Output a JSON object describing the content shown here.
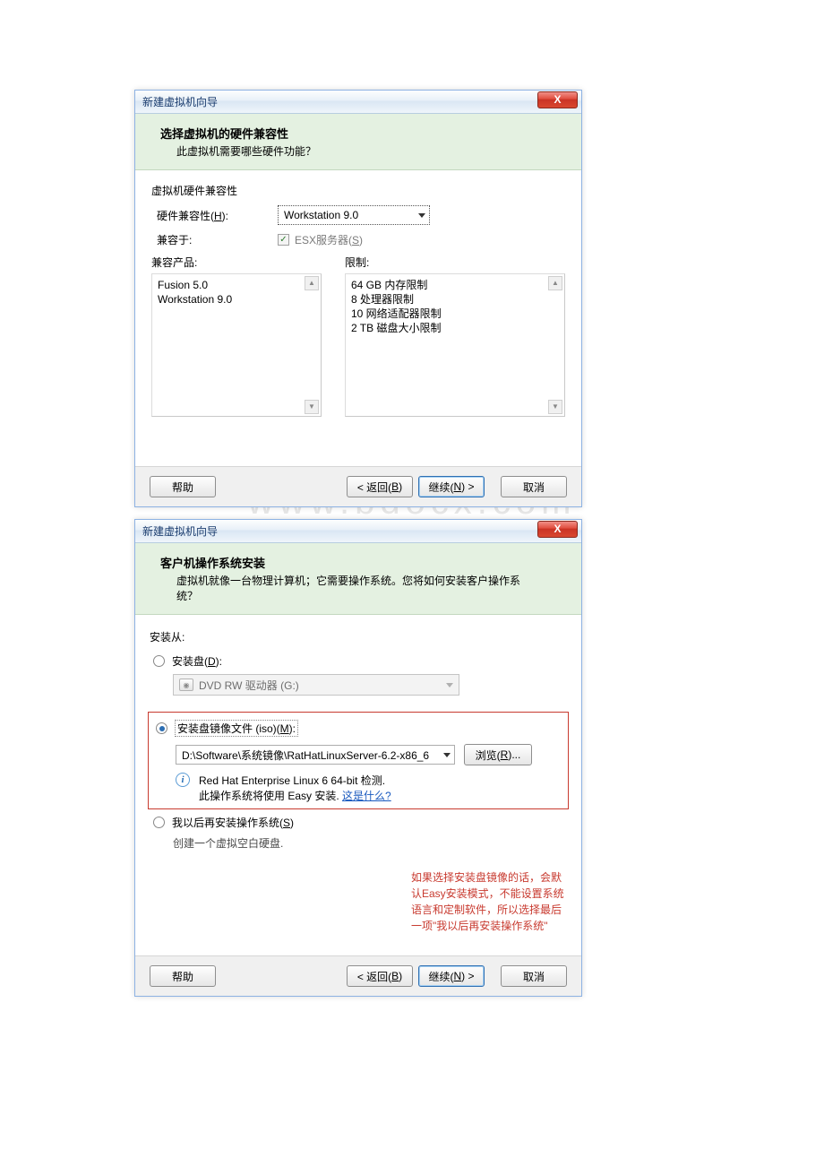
{
  "watermark": "www.bdocx.com",
  "dialog1": {
    "title": "新建虚拟机向导",
    "close_x": "X",
    "header_title": "选择虚拟机的硬件兼容性",
    "header_sub": "此虚拟机需要哪些硬件功能？",
    "compat_section": "虚拟机硬件兼容性",
    "hw_compat_label_pre": "硬件兼容性(",
    "hw_compat_key": "H",
    "hw_compat_label_post": "):",
    "hw_compat_value": "Workstation 9.0",
    "compat_with_label": "兼容于:",
    "esx_label_pre": "ESX服务器(",
    "esx_key": "S",
    "esx_label_post": ")",
    "esx_check": "✓",
    "compat_products_label": "兼容产品:",
    "limits_label": "限制:",
    "products": [
      "Fusion 5.0",
      "Workstation 9.0"
    ],
    "limits": [
      "64 GB 内存限制",
      "8 处理器限制",
      "10 网络适配器限制",
      "2 TB 磁盘大小限制"
    ],
    "buttons": {
      "help": "帮助",
      "back_pre": "< 返回(",
      "back_key": "B",
      "back_post": ")",
      "next_pre": "继续(",
      "next_key": "N",
      "next_post": ") >",
      "cancel": "取消"
    }
  },
  "dialog2": {
    "title": "新建虚拟机向导",
    "close_x": "X",
    "header_title": "客户机操作系统安装",
    "header_sub": "虚拟机就像一台物理计算机；它需要操作系统。您将如何安装客户操作系统？",
    "install_from": "安装从:",
    "opt_disk_pre": "安装盘(",
    "opt_disk_key": "D",
    "opt_disk_post": "):",
    "drive_text": "DVD RW 驱动器 (G:)",
    "opt_iso_pre": "安装盘镜像文件 (iso)(",
    "opt_iso_key": "M",
    "opt_iso_post": "):",
    "iso_path": "D:\\Software\\系统镜像\\RatHatLinuxServer-6.2-x86_6",
    "browse_pre": "浏览(",
    "browse_key": "R",
    "browse_post": "...",
    "detected_line": "Red Hat Enterprise Linux 6 64-bit 检测.",
    "easy_install_prefix": "此操作系统将使用 Easy 安装. ",
    "easy_install_link": "这是什么?",
    "opt_later_pre": "我以后再安装操作系统(",
    "opt_later_key": "S",
    "opt_later_post": ")",
    "later_desc": "创建一个虚拟空白硬盘.",
    "red_note": "如果选择安装盘镜像的话，会默认Easy安装模式，不能设置系统语言和定制软件，所以选择最后一项\"我以后再安装操作系统\"",
    "buttons": {
      "help": "帮助",
      "back_pre": "< 返回(",
      "back_key": "B",
      "back_post": ")",
      "next_pre": "继续(",
      "next_key": "N",
      "next_post": ") >",
      "cancel": "取消"
    }
  }
}
